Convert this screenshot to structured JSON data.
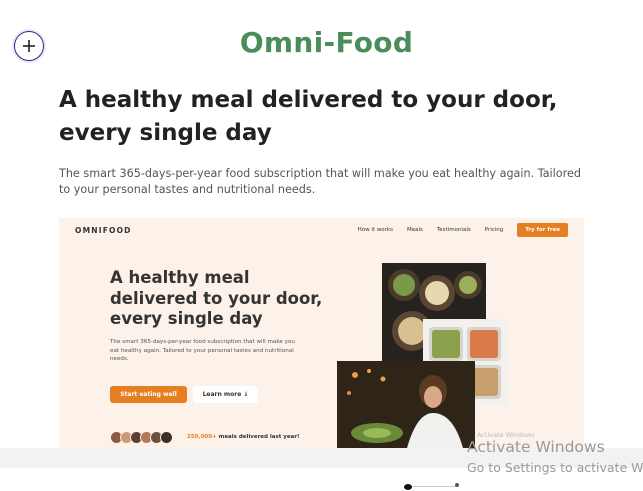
{
  "brand": {
    "title": "Omni-Food"
  },
  "hero": {
    "headline": "A healthy meal delivered to your door, every single day",
    "description": "The smart 365-days-per-year food subscription that will make you eat healthy again. Tailored to your personal tastes and nutritional needs."
  },
  "preview": {
    "logo": "OMNIFOOD",
    "nav": [
      "How it works",
      "Meals",
      "Testimonials",
      "Pricing"
    ],
    "nav_cta": "Try for free",
    "headline": "A healthy meal delivered to your door, every single day",
    "text": "The smart 365-days-per-year food subscription that will make you eat healthy again. Tailored to your personal tastes and nutritional needs.",
    "primary_button": "Start eating well",
    "secondary_button": "Learn more ↓",
    "served_number": "250,000+",
    "served_text": "meals delivered last year!",
    "watermark": "Activate Windows",
    "accent": "#e67e22",
    "background": "#fdf2e9"
  },
  "add_button": {
    "icon": "plus-circle-icon"
  },
  "windows": {
    "title": "Activate Windows",
    "subtitle": "Go to Settings to activate W"
  },
  "colors": {
    "brand": "#4a8c5a"
  }
}
